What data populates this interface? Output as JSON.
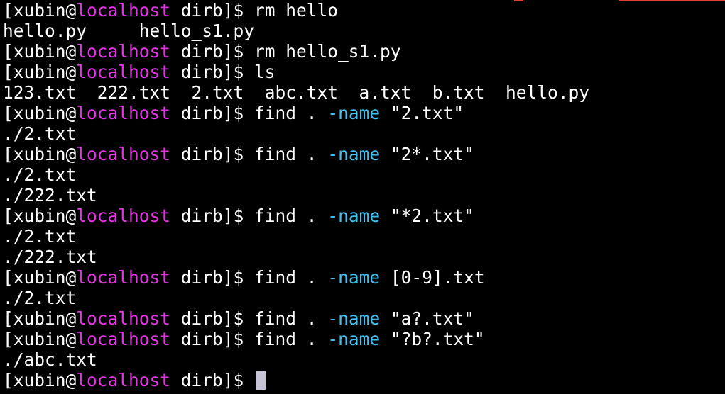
{
  "colors": {
    "background": "#000000",
    "text": "#ffffff",
    "hostname": "#e534e5",
    "option": "#40c0f0",
    "cursor": "#c4c4d6"
  },
  "prompt": {
    "open": "[xubin@",
    "host": "localhost",
    "close": " dirb]$ "
  },
  "lines": [
    {
      "type": "command",
      "parts": [
        {
          "text": "rm hello",
          "style": "normal"
        }
      ]
    },
    {
      "type": "output",
      "text": "hello.py     hello_s1.py"
    },
    {
      "type": "command",
      "parts": [
        {
          "text": "rm hello_s1.py",
          "style": "normal"
        }
      ]
    },
    {
      "type": "command",
      "parts": [
        {
          "text": "ls",
          "style": "normal"
        }
      ]
    },
    {
      "type": "output",
      "text": "123.txt  222.txt  2.txt  abc.txt  a.txt  b.txt  hello.py"
    },
    {
      "type": "command",
      "parts": [
        {
          "text": "find . ",
          "style": "normal"
        },
        {
          "text": "-name",
          "style": "opt"
        },
        {
          "text": " \"2.txt\"",
          "style": "normal"
        }
      ]
    },
    {
      "type": "output",
      "text": "./2.txt"
    },
    {
      "type": "command",
      "parts": [
        {
          "text": "find . ",
          "style": "normal"
        },
        {
          "text": "-name",
          "style": "opt"
        },
        {
          "text": " \"2*.txt\"",
          "style": "normal"
        }
      ]
    },
    {
      "type": "output",
      "text": "./2.txt"
    },
    {
      "type": "output",
      "text": "./222.txt"
    },
    {
      "type": "command",
      "parts": [
        {
          "text": "find . ",
          "style": "normal"
        },
        {
          "text": "-name",
          "style": "opt"
        },
        {
          "text": " \"*2.txt\"",
          "style": "normal"
        }
      ]
    },
    {
      "type": "output",
      "text": "./2.txt"
    },
    {
      "type": "output",
      "text": "./222.txt"
    },
    {
      "type": "command",
      "parts": [
        {
          "text": "find . ",
          "style": "normal"
        },
        {
          "text": "-name",
          "style": "opt"
        },
        {
          "text": " [0-9].txt",
          "style": "normal"
        }
      ]
    },
    {
      "type": "output",
      "text": "./2.txt"
    },
    {
      "type": "command",
      "parts": [
        {
          "text": "find . ",
          "style": "normal"
        },
        {
          "text": "-name",
          "style": "opt"
        },
        {
          "text": " \"a?.txt\"",
          "style": "normal"
        }
      ]
    },
    {
      "type": "command",
      "parts": [
        {
          "text": "find . ",
          "style": "normal"
        },
        {
          "text": "-name",
          "style": "opt"
        },
        {
          "text": " \"?b?.txt\"",
          "style": "normal"
        }
      ]
    },
    {
      "type": "output",
      "text": "./abc.txt"
    },
    {
      "type": "command",
      "parts": [],
      "cursor": true
    }
  ]
}
